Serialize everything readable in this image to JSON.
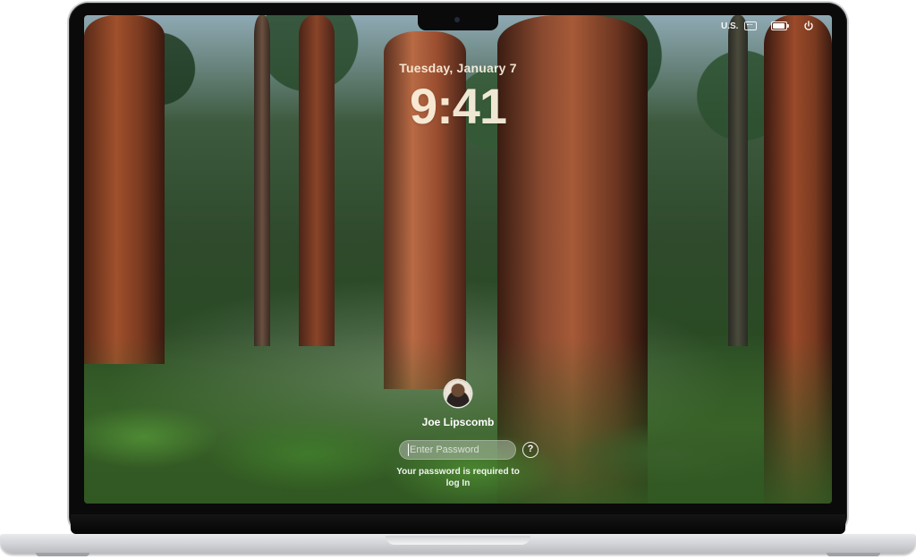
{
  "menubar": {
    "input_source": "U.S.",
    "battery_level_percent": 90,
    "icons": [
      "keyboard-icon",
      "battery-icon",
      "power-icon"
    ]
  },
  "lock_screen": {
    "date": "Tuesday, January 7",
    "time": "9:41",
    "user_name": "Joe Lipscomb",
    "password_placeholder": "Enter Password",
    "password_value": "",
    "help_glyph": "?",
    "hint": "Your password is required to log In"
  },
  "colors": {
    "clock_text": "#fff5e1",
    "bezel": "#0a0a0a",
    "chassis": "#d3d5d8",
    "field_bg": "#c8cdc8"
  }
}
